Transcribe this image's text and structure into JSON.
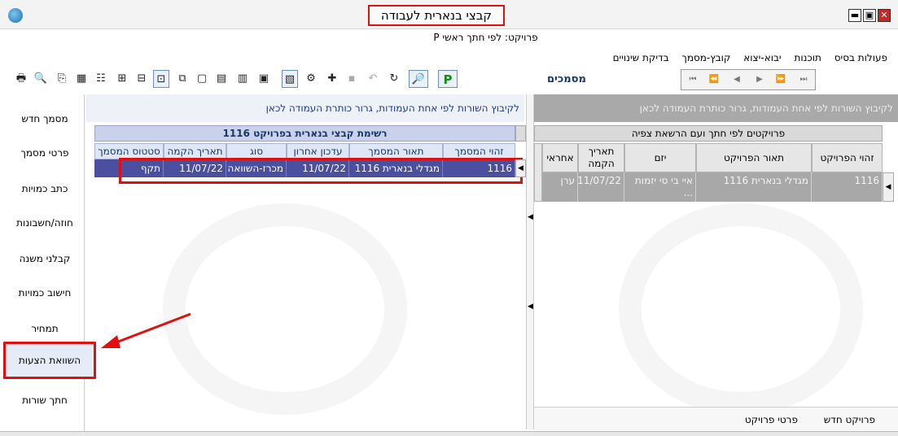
{
  "window": {
    "title": "קבצי בנארית לעבודה",
    "subtitle": "פרויקט: לפי חתך ראשי P",
    "buttons": {
      "minimize": "▬",
      "maximize": "▣",
      "close": "✕"
    }
  },
  "menu": {
    "items": [
      "פעולות בסיס",
      "תוכנות",
      "יבוא-יצוא",
      "קובץ-מסמך",
      "בדיקת שינויים"
    ]
  },
  "toolbar": {
    "icons": [
      "printer-icon",
      "print-preview-icon",
      "export-icon",
      "excel-icon",
      "tree-icon",
      "tree2-icon",
      "tree3-icon",
      "tree4-icon",
      "copy-icon",
      "new-icon",
      "doc-icon",
      "doc2-icon",
      "image-icon",
      "report-icon",
      "settings-icon",
      "add-icon",
      "save-icon",
      "undo-icon",
      "refresh-icon",
      "search-icon",
      "p-icon"
    ],
    "glyphs": [
      "🖶",
      "🔍",
      "⎘",
      "▦",
      "☷",
      "⊞",
      "⊟",
      "⊡",
      "⧉",
      "▢",
      "▤",
      "▥",
      "▣",
      "▧",
      "⚙",
      "✚",
      "▪",
      "↶",
      "↻",
      "🔎",
      "P"
    ],
    "docs_label": "מסמכים",
    "nav": [
      "⏮",
      "⏪",
      "◀",
      "▶",
      "⏩",
      "⏭"
    ]
  },
  "sidebar": {
    "items": [
      "מסמך חדש",
      "פרטי מסמך",
      "כתב כמויות",
      "חוזה/חשבונות",
      "קבלני משנה",
      "חישוב כמויות",
      "תמחיר",
      "השוואת הצעות",
      "חתך שורות"
    ],
    "active_index": 7
  },
  "middle": {
    "hint": "לקיבוץ השורות לפי אחת העמודות, גרור כותרת העמודה לכאן",
    "grid_title": "רשימת קבצי בנארית בפרויקט 1116",
    "columns": [
      "זהוי המסמך",
      "תאור המסמך",
      "עדכון אחרון",
      "סוג",
      "תאריך הקמה",
      "סטטוס המסמך"
    ],
    "rows": [
      [
        "1116",
        "מגדלי בנארית 1116",
        "11/07/22",
        "מכרז-השוואה",
        "11/07/22",
        "תקף"
      ]
    ]
  },
  "right": {
    "hint": "לקיבוץ השורות לפי אחת העמודות, גרור כותרת העמודה לכאן",
    "grid_title": "פרויקטים לפי חתך ועם הרשאת צפיה",
    "columns": [
      "זהוי הפרויקט",
      "תאור הפרויקט",
      "יזם",
      "תאריך הקמה",
      "אחראי"
    ],
    "rows": [
      [
        "1116",
        "מגדלי בנארית 1116",
        "איי בי סי יזמות ...",
        "11/07/22",
        "ערן"
      ]
    ],
    "bottom_buttons": [
      "פרויקט חדש",
      "פרטי פרויקט"
    ]
  },
  "colors": {
    "highlight_red": "#e01010",
    "selected_row": "#4a4fa0",
    "header_blue": "#17376b"
  }
}
